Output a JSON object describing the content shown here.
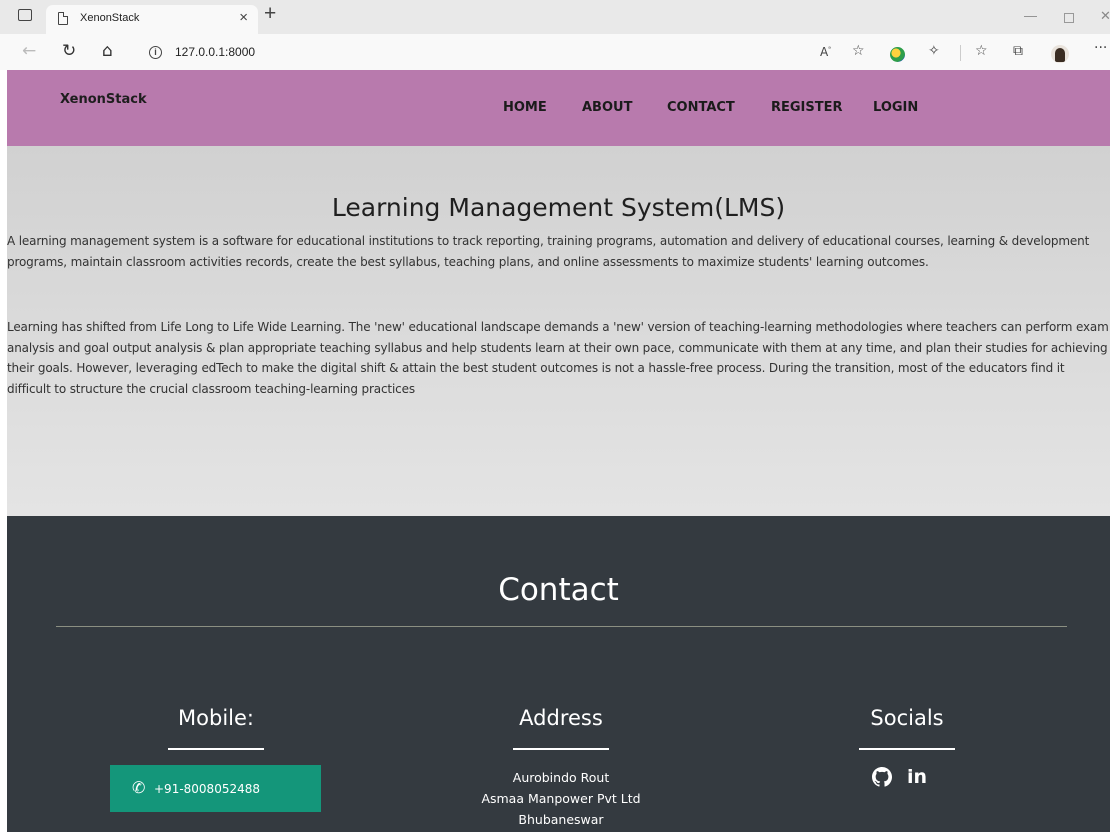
{
  "browser": {
    "tab_title": "XenonStack",
    "tab_close": "×",
    "new_tab": "+",
    "url": "127.0.0.1:8000",
    "icons": [
      "tab-actions-icon",
      "page-icon",
      "back-icon",
      "refresh-icon",
      "home-icon",
      "info-icon",
      "read-aloud-icon",
      "add-favorite-icon",
      "extension-icon",
      "extensions-icon",
      "favorites-icon",
      "collections-icon",
      "profile-avatar",
      "more-icon"
    ]
  },
  "site": {
    "brand": "XenonStack",
    "nav": [
      "HOME",
      "ABOUT",
      "CONTACT",
      "REGISTER",
      "LOGIN"
    ],
    "header_color": "#b87aad"
  },
  "hero": {
    "title": "Learning Management System(LMS)",
    "paragraph1": "A learning management system is a software for educational institutions to track reporting, training programs, automation and delivery of educational courses, learning & development programs, maintain classroom activities records, create the best syllabus, teaching plans, and online assessments to maximize students' learning outcomes.",
    "paragraph2": "Learning has shifted from Life Long to Life Wide Learning. The 'new' educational landscape demands a 'new' version of teaching-learning methodologies where teachers can perform exam analysis and goal output analysis & plan appropriate teaching syllabus and help students learn at their own pace, communicate with them at any time, and plan their studies for achieving their goals. However, leveraging edTech to make the digital shift & attain the best student outcomes is not a hassle-free process. During the transition, most of the educators find it difficult to structure the crucial classroom teaching-learning practices"
  },
  "contact": {
    "title": "Contact",
    "mobile_title": "Mobile:",
    "phone": "+91-8008052488",
    "address_title": "Address",
    "address_lines": [
      "Aurobindo Rout",
      "Asmaa Manpower Pvt Ltd",
      "Bhubaneswar"
    ],
    "socials_title": "Socials",
    "socials": [
      "github-icon",
      "linkedin-icon"
    ],
    "background_color": "#343a40",
    "phone_button_color": "#14967a"
  }
}
